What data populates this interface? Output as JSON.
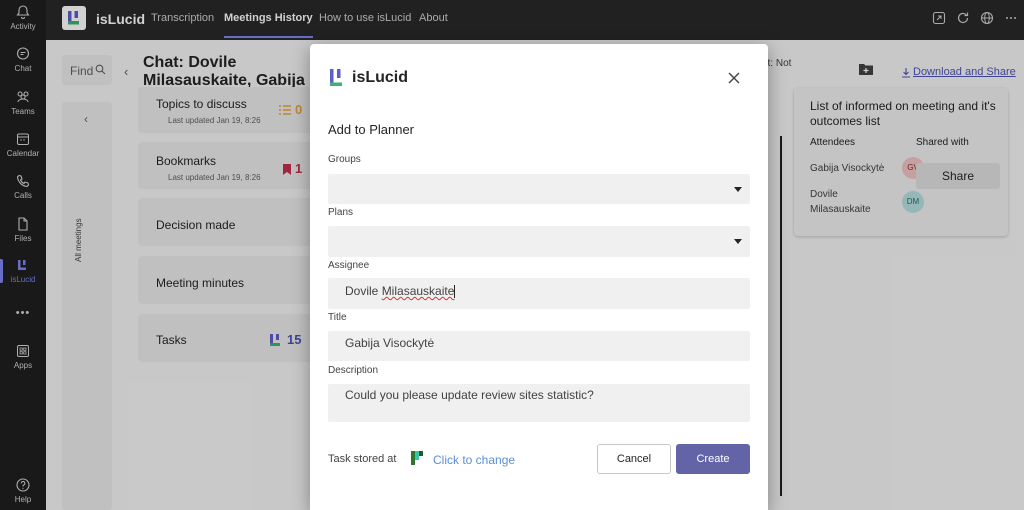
{
  "rail": {
    "items": [
      {
        "label": "Activity",
        "icon": "bell-icon"
      },
      {
        "label": "Chat",
        "icon": "chat-icon"
      },
      {
        "label": "Teams",
        "icon": "teams-icon"
      },
      {
        "label": "Calendar",
        "icon": "calendar-icon"
      },
      {
        "label": "Calls",
        "icon": "phone-icon"
      },
      {
        "label": "Files",
        "icon": "file-icon"
      },
      {
        "label": "isLucid",
        "icon": "islucid-icon"
      },
      {
        "label": "Apps",
        "icon": "apps-icon"
      },
      {
        "label": "Help",
        "icon": "help-icon"
      }
    ],
    "more": "•••"
  },
  "topbar": {
    "app_name": "isLucid",
    "tabs": [
      {
        "label": "Transcription"
      },
      {
        "label": "Meetings History"
      },
      {
        "label": "How to use isLucid"
      },
      {
        "label": "About"
      }
    ]
  },
  "main": {
    "find_label": "Find",
    "chat_title": "Chat: Dovile Milasauskaite, Gabija Visockytė",
    "side_label": "All meetings",
    "cards": [
      {
        "title": "Topics to discuss",
        "sub": "Last updated Jan 19, 8:26",
        "count": "0"
      },
      {
        "title": "Bookmarks",
        "sub": "Last updated Jan 19, 8:26",
        "count": "1"
      },
      {
        "title": "Decision made"
      },
      {
        "title": "Meeting minutes"
      },
      {
        "title": "Tasks",
        "count": "15"
      }
    ],
    "right_head_text": "nt: Not",
    "download_label": "Download and Share"
  },
  "informed": {
    "title": "List of informed on meeting and it's outcomes list",
    "col_attendees": "Attendees",
    "col_shared": "Shared with",
    "attendees": [
      {
        "name": "Gabija Visockytė",
        "initials": "GV"
      },
      {
        "name": "Dovile Milasauskaite",
        "initials": "DM"
      }
    ],
    "share_label": "Share"
  },
  "modal": {
    "brand": "isLucid",
    "heading": "Add to Planner",
    "groups_label": "Groups",
    "groups_value": "",
    "plans_label": "Plans",
    "plans_value": "",
    "assignee_label": "Assignee",
    "assignee_first": "Dovile ",
    "assignee_last": "Milasauskaite",
    "title_label": "Title",
    "title_value": "Gabija Visockytė",
    "description_label": "Description",
    "description_value": "Could you please update review sites statistic?",
    "stored_label": "Task stored at",
    "click_change": "Click to change",
    "cancel_label": "Cancel",
    "create_label": "Create"
  },
  "colors": {
    "accent": "#6264a7",
    "rail_active": "#7f85f5",
    "bookmark_red": "#c4314b",
    "topics_orange": "#e8a33d",
    "link_blue": "#5b8fd6"
  }
}
